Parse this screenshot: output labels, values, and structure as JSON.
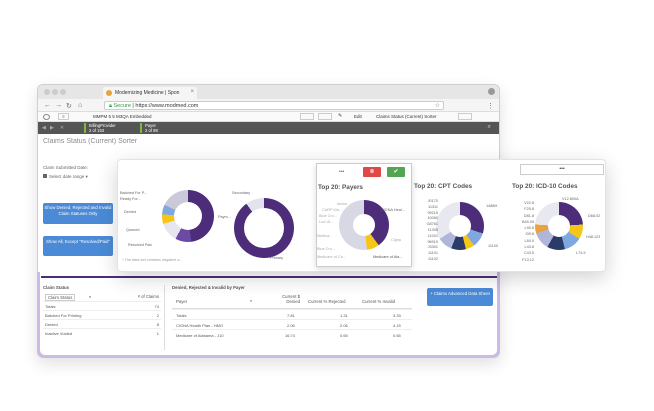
{
  "browser": {
    "tab_title": "Modernizing Medicine | Spon",
    "url_secure": "Secure",
    "url": "https://www.modmed.com",
    "app_label": "MMPM 5 5 M3QA Embedded",
    "edit_label": "Edit",
    "sheet_selector": "Claims Status (Current) Sorter"
  },
  "selections": [
    {
      "field": "BillingProvider",
      "value": "2 of 153"
    },
    {
      "field": "Payer",
      "value": "2 of 98"
    }
  ],
  "sheet": {
    "title": "Claims Status (Current) Sorter",
    "date_label": "Claim Submitted Date:",
    "date_placeholder": "Select date range",
    "btn_show_denied": "Show Denied, Rejected and Invalid Claim Statuses Only",
    "btn_show_all": "Show All, Except \"Resolved/Paid\"",
    "btn_advanced": "+ Claims Advanced Data Sheet"
  },
  "claim_status": {
    "title": "Claim Status",
    "col1": "Claim Status",
    "col2": "# of Claims",
    "rows": [
      {
        "status": "Totals",
        "count": "74"
      },
      {
        "status": "Batched For Printing",
        "count": "2"
      },
      {
        "status": "Denied",
        "count": "8"
      },
      {
        "status": "Inactive Voided",
        "count": "1"
      }
    ]
  },
  "payer_table": {
    "title": "Denied, Rejected & Invalid by Payer",
    "cols": [
      "Payer",
      "Current $ Denied",
      "Current % Rejected",
      "Current % Invalid"
    ],
    "rows": [
      [
        "Totals",
        "7.81",
        "1.31",
        "3.33"
      ],
      [
        "CIGNA Health Plan - HMO",
        "2.06",
        "2.06",
        "4.15"
      ],
      [
        "Medicare of Alabama - J10",
        "16.74",
        "0.65",
        "0.65"
      ]
    ]
  },
  "status_chart": {
    "labels": [
      "Batched For P...",
      "Ready For...",
      "Denied",
      "Queued",
      "Resolved Paid"
    ],
    "right_label": "Paym...",
    "note": "* The data set contains negative o..."
  },
  "primary_chart": {
    "top": "Secondary",
    "bottom": "Primary"
  },
  "payers": {
    "title": "Top 20: Payers",
    "labels_left": [
      "Aetna",
      "CARP Ma...",
      "Blue Cro...",
      "Loc/ Al...",
      "Medica...",
      "Blue Cro...",
      "Medicare of Ca..."
    ],
    "labels_right": [
      "CIGNA Heal...",
      "Cigna",
      "Medicare of Ala..."
    ]
  },
  "cpt": {
    "title": "Top 20: CPT Codes",
    "labels_left": [
      "J0170",
      "11311",
      "99215",
      "10060",
      "G8761",
      "11305",
      "11001",
      "96910",
      "J3301",
      "11101",
      "11102"
    ],
    "labels_right": [
      "1488H",
      "11100"
    ]
  },
  "icd": {
    "title": "Top 20: ICD-10 Codes",
    "labels_left": [
      "V22.8",
      "F25.8",
      "D81.8",
      "B45.09",
      "L90.8",
      "I09.8",
      "L84.0",
      "L43.8",
      "C43.5",
      "F13.12"
    ],
    "labels_right": [
      "V12.800A",
      "D68.02",
      "H48.123",
      "L74.9"
    ]
  },
  "menu_label": "•••"
}
